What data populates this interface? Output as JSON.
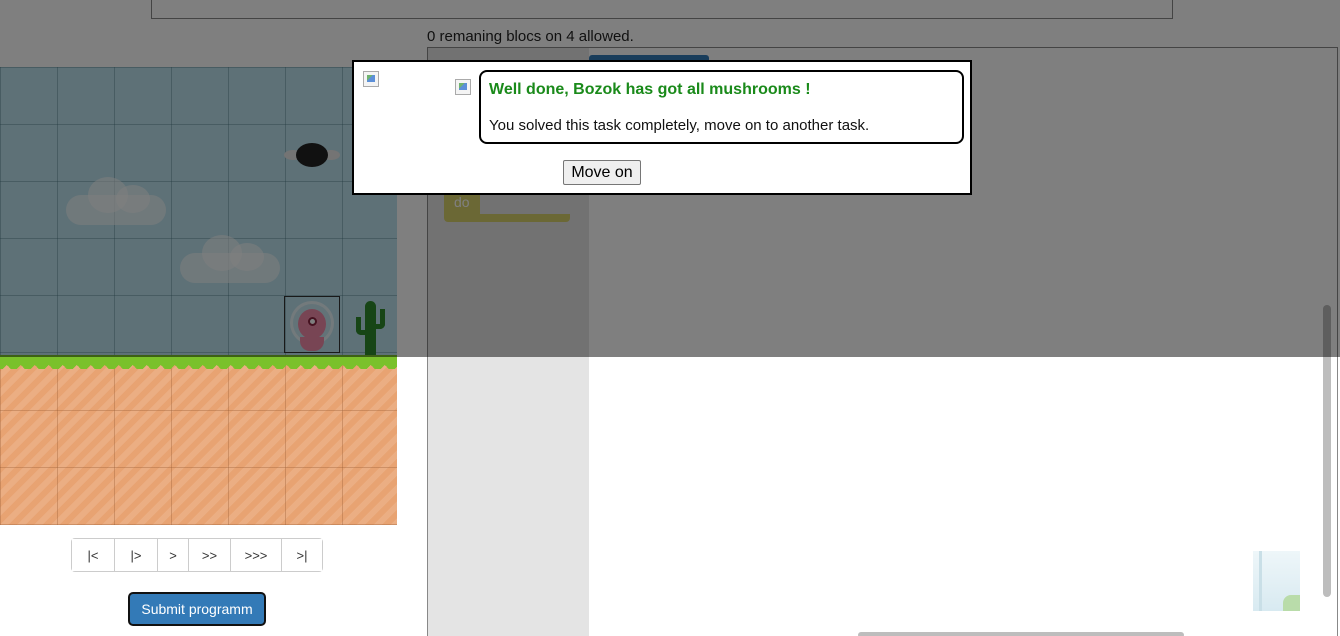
{
  "status": {
    "remaining_blocks": "0 remaning blocs on 4 allowed."
  },
  "workspace": {
    "block_label": "do"
  },
  "controls": {
    "buttons": [
      {
        "label": "|<",
        "icon": "go-to-start-icon"
      },
      {
        "label": "|>",
        "icon": "step-icon"
      },
      {
        "label": ">",
        "icon": "play-icon"
      },
      {
        "label": ">>",
        "icon": "fast-forward-icon"
      },
      {
        "label": ">>>",
        "icon": "fastest-icon"
      },
      {
        "label": ">|",
        "icon": "go-to-end-icon"
      }
    ],
    "submit_label": "Submit programm"
  },
  "dialog": {
    "title": "Well done, Bozok has got all mushrooms !",
    "message": "You solved this task completely, move on to another task.",
    "button_label": "Move on"
  },
  "colors": {
    "success_text": "#1a8a1a",
    "submit_bg": "#337ab7",
    "block_color": "#d6d06a",
    "toolbox_bg": "#e4e4e4",
    "overlay": "rgba(0,0,0,0.5)"
  }
}
